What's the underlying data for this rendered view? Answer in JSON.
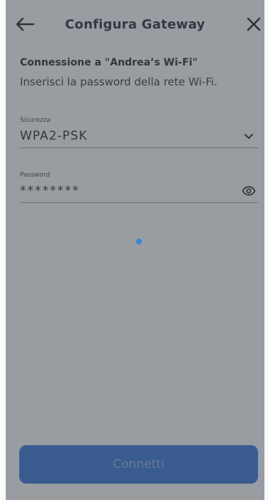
{
  "header": {
    "title": "Configura Gateway",
    "back_icon": "arrow-left-icon",
    "close_icon": "close-icon"
  },
  "connection": {
    "title": "Connessione a \"Andrea’s Wi-Fi\"",
    "subtitle": "Inserisci la password della rete Wi-Fi."
  },
  "security": {
    "label": "Sicurezza",
    "value": "WPA2-PSK",
    "icon": "chevron-down-icon"
  },
  "password": {
    "label": "Password",
    "value": "********",
    "icon": "eye-icon"
  },
  "actions": {
    "connect_label": "Connetti"
  },
  "colors": {
    "accent": "#2a6fdb",
    "button_disabled_text": "#8fb1e8",
    "overlay": "#464a52"
  },
  "state": {
    "loading": true
  }
}
